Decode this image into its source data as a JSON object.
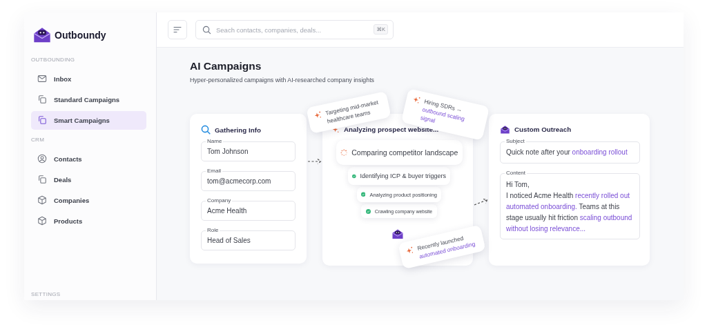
{
  "logo": {
    "name": "Outboundy"
  },
  "search": {
    "placeholder": "Seach contacts, companies, deals...",
    "shortcut": "⌘K"
  },
  "sidebar": {
    "sections": [
      {
        "label": "OUTBOUNDING",
        "items": [
          {
            "label": "Inbox",
            "kind": "mail",
            "selected": false
          },
          {
            "label": "Standard Campaigns",
            "kind": "copy",
            "selected": false
          },
          {
            "label": "Smart Campaigns",
            "kind": "copy",
            "selected": true
          }
        ]
      },
      {
        "label": "CRM",
        "items": [
          {
            "label": "Contacts",
            "kind": "user",
            "selected": false
          },
          {
            "label": "Deals",
            "kind": "copy",
            "selected": false
          },
          {
            "label": "Companies",
            "kind": "cube",
            "selected": false
          },
          {
            "label": "Products",
            "kind": "cube",
            "selected": false
          }
        ]
      }
    ],
    "footer_label": "SETTINGS"
  },
  "page": {
    "title": "AI Campaigns",
    "subtitle": "Hyper-personalized campaigns with AI-researched company insights"
  },
  "gathering": {
    "title": "Gathering Info",
    "fields": [
      {
        "label": "Name",
        "value": "Tom Johnson"
      },
      {
        "label": "Email",
        "value": "tom@acmecorp.com"
      },
      {
        "label": "Company",
        "value": "Acme Health"
      },
      {
        "label": "Role",
        "value": "Head of Sales"
      }
    ]
  },
  "analyzing": {
    "title": "Analyzing prospect website...",
    "steps": [
      {
        "label": "Comparing competitor landscape",
        "kind": "active"
      },
      {
        "label": "Identifying ICP & buyer triggers",
        "kind": "done"
      },
      {
        "label": "Analyzing product positioning",
        "kind": "done"
      },
      {
        "label": "Crawling company website",
        "kind": "done"
      }
    ]
  },
  "insights": [
    {
      "segments": [
        {
          "text": "Targeting mid-market healthcare teams",
          "highlight": false
        }
      ]
    },
    {
      "segments": [
        {
          "text": "Hiring SDRs → ",
          "highlight": false
        },
        {
          "text": "outbound scaling signal",
          "highlight": true
        }
      ]
    },
    {
      "segments": [
        {
          "text": "Recently launched ",
          "highlight": false
        },
        {
          "text": "automated onboarding",
          "highlight": true
        }
      ]
    }
  ],
  "outreach": {
    "title": "Custom Outreach",
    "subject": {
      "label": "Subject",
      "segments": [
        {
          "text": "Quick note after your ",
          "highlight": false
        },
        {
          "text": "onboarding rollout",
          "highlight": true
        }
      ]
    },
    "content": {
      "label": "Content",
      "greeting": "Hi Tom,",
      "segments": [
        {
          "text": "I noticed Acme Health ",
          "highlight": false
        },
        {
          "text": "recently rolled out automated onboarding.",
          "highlight": true
        },
        {
          "text": " Teams at this stage usually hit friction ",
          "highlight": false
        },
        {
          "text": "scaling outbound without losing relevance...",
          "highlight": true
        }
      ]
    }
  }
}
